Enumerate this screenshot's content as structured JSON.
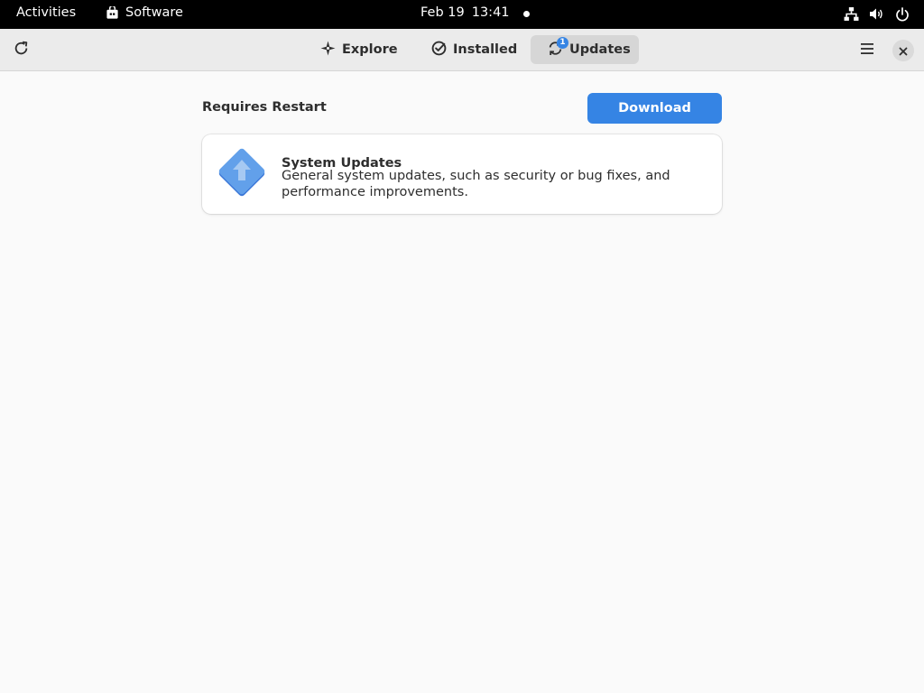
{
  "topbar": {
    "activities": "Activities",
    "app_name": "Software",
    "date": "Feb 19",
    "time": "13:41"
  },
  "headerbar": {
    "tabs": [
      {
        "label": "Explore",
        "icon": "explore-icon"
      },
      {
        "label": "Installed",
        "icon": "installed-check-icon"
      },
      {
        "label": "Updates",
        "icon": "updates-icon",
        "badge": "1",
        "active": true
      }
    ]
  },
  "main": {
    "section_title": "Requires Restart",
    "download_label": "Download",
    "update": {
      "name": "System Updates",
      "description": "General system updates, such as security or bug fixes, and performance improvements."
    }
  },
  "colors": {
    "accent": "#3584e4",
    "topbar": "#000000",
    "headerbar": "#ebebeb",
    "background": "#fafafa"
  }
}
